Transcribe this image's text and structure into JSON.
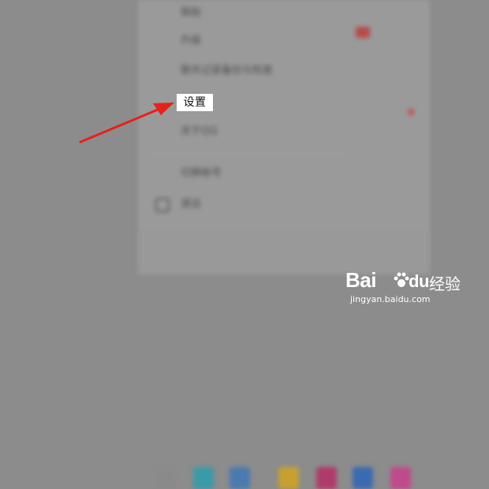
{
  "menu": {
    "items": [
      {
        "label": "帮助"
      },
      {
        "label": "升级"
      },
      {
        "label": "聊天记录备份与恢复"
      },
      {
        "label": "设置"
      },
      {
        "label": "关于QQ"
      },
      {
        "label": "切换帐号"
      },
      {
        "label": "退出"
      }
    ],
    "highlighted_label": "设置"
  },
  "annotation": {
    "arrow_color": "#e8201a"
  },
  "watermark": {
    "brand": "Bai",
    "brand_suffix": "du",
    "cn": "经验",
    "url": "jingyan.baidu.com"
  }
}
